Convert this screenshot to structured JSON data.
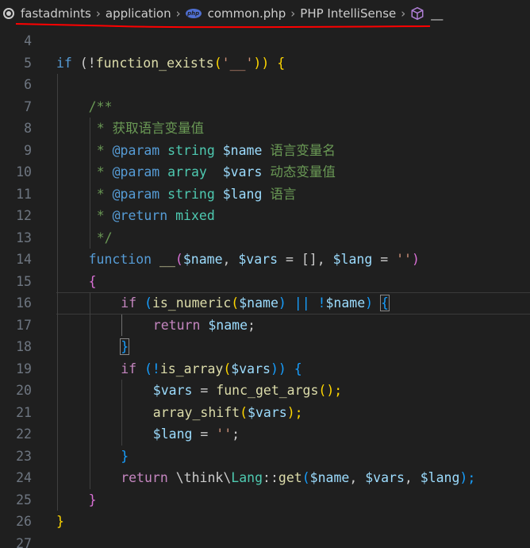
{
  "breadcrumb": {
    "items": [
      "fastadmints",
      "application",
      "common.php",
      "PHP IntelliSense",
      "__"
    ],
    "php_badge": "php"
  },
  "editor": {
    "lines": [
      {
        "n": "4"
      },
      {
        "n": "5",
        "t": [
          "if",
          " (!",
          "function_exists",
          "(",
          "'__'",
          ")) {"
        ]
      },
      {
        "n": "6"
      },
      {
        "n": "7",
        "t": [
          "/**"
        ]
      },
      {
        "n": "8",
        "t": [
          "* 获取语言变量值"
        ]
      },
      {
        "n": "9",
        "t": [
          "* ",
          "@param",
          " ",
          "string",
          " ",
          "$name",
          " 语言变量名"
        ]
      },
      {
        "n": "10",
        "t": [
          "* ",
          "@param",
          " ",
          "array",
          "  ",
          "$vars",
          " 动态变量值"
        ]
      },
      {
        "n": "11",
        "t": [
          "* ",
          "@param",
          " ",
          "string",
          " ",
          "$lang",
          " 语言"
        ]
      },
      {
        "n": "12",
        "t": [
          "* ",
          "@return",
          " ",
          "mixed"
        ]
      },
      {
        "n": "13",
        "t": [
          "*/"
        ]
      },
      {
        "n": "14",
        "t": [
          "function",
          " ",
          "__",
          "(",
          "$name",
          ", ",
          "$vars",
          " = [], ",
          "$lang",
          " = ",
          "''",
          ")"
        ]
      },
      {
        "n": "15",
        "t": [
          "{"
        ]
      },
      {
        "n": "16",
        "t": [
          "if",
          " (",
          "is_numeric",
          "(",
          "$name",
          ") || !",
          "$name",
          ") ",
          "{"
        ]
      },
      {
        "n": "17",
        "t": [
          "return",
          " ",
          "$name",
          ";"
        ]
      },
      {
        "n": "18",
        "t": [
          "}"
        ]
      },
      {
        "n": "19",
        "t": [
          "if",
          " (!",
          "is_array",
          "(",
          "$vars",
          ")) {"
        ]
      },
      {
        "n": "20",
        "t": [
          "$vars",
          " = ",
          "func_get_args",
          "();"
        ]
      },
      {
        "n": "21",
        "t": [
          "array_shift",
          "(",
          "$vars",
          ");"
        ]
      },
      {
        "n": "22",
        "t": [
          "$lang",
          " = ",
          "''",
          ";"
        ]
      },
      {
        "n": "23",
        "t": [
          "}"
        ]
      },
      {
        "n": "24",
        "t": [
          "return",
          " \\think\\",
          "Lang",
          "::",
          "get",
          "(",
          "$name",
          ", ",
          "$vars",
          ", ",
          "$lang",
          ");"
        ]
      },
      {
        "n": "25",
        "t": [
          "}"
        ]
      },
      {
        "n": "26",
        "t": [
          "}"
        ]
      },
      {
        "n": "27"
      }
    ]
  },
  "colors": {
    "background": "#1f1f1f",
    "annotation_underline": "#ff0000"
  }
}
